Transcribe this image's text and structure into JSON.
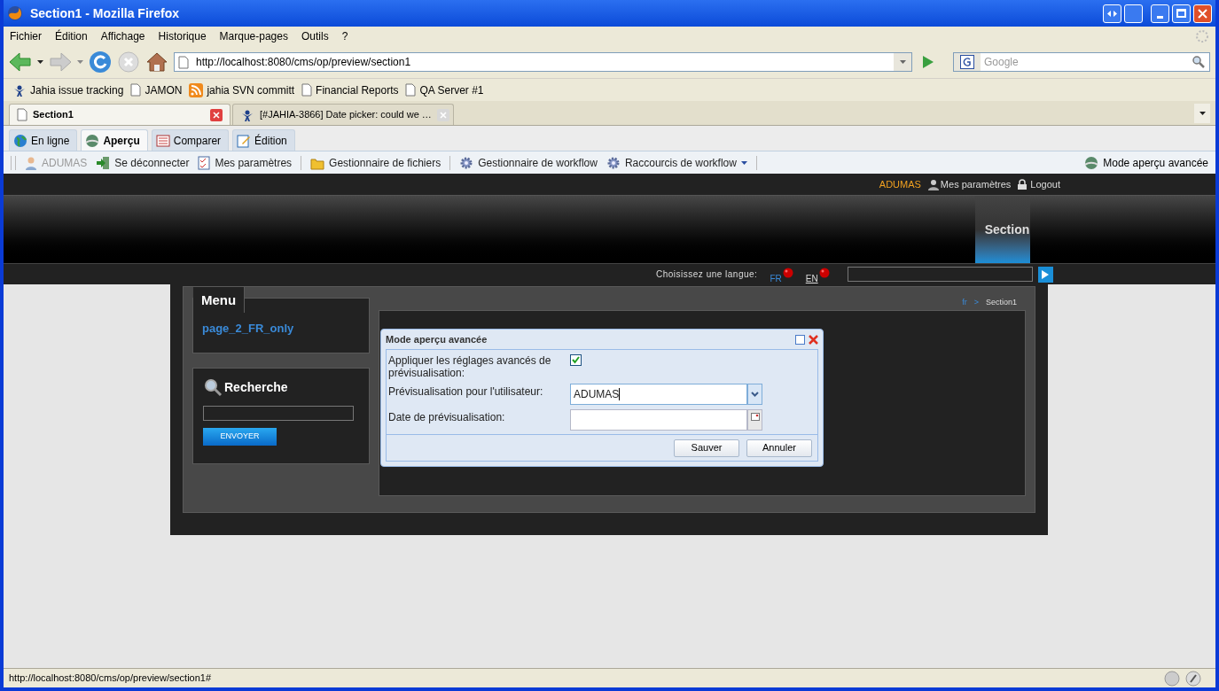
{
  "window": {
    "title": "Section1 - Mozilla Firefox"
  },
  "menu_bar": [
    "Fichier",
    "Édition",
    "Affichage",
    "Historique",
    "Marque-pages",
    "Outils",
    "?"
  ],
  "address_bar": {
    "value": "http://localhost:8080/cms/op/preview/section1"
  },
  "search": {
    "placeholder": "Google"
  },
  "bookmarks": [
    {
      "label": "Jahia issue tracking",
      "kind": "jahia"
    },
    {
      "label": "JAMON",
      "kind": "page"
    },
    {
      "label": "jahia SVN committ",
      "kind": "feed"
    },
    {
      "label": "Financial Reports",
      "kind": "page"
    },
    {
      "label": "QA Server #1",
      "kind": "page"
    }
  ],
  "browser_tabs": [
    {
      "label": "Section1",
      "selected": true,
      "kind": "page"
    },
    {
      "label": "[#JAHIA-3866] Date picker: could we …",
      "selected": false,
      "kind": "jahia"
    }
  ],
  "mode_tabs": [
    {
      "label": "En ligne",
      "selected": false,
      "kind": "globe"
    },
    {
      "label": "Aperçu",
      "selected": true,
      "kind": "preview"
    },
    {
      "label": "Comparer",
      "selected": false,
      "kind": "compare"
    },
    {
      "label": "Édition",
      "selected": false,
      "kind": "edit"
    }
  ],
  "toolbar": {
    "items": [
      {
        "label": "ADUMAS",
        "kind": "user",
        "disabled": true
      },
      {
        "label": "Se déconnecter",
        "kind": "logout",
        "disabled": false
      },
      {
        "label": "Mes paramètres",
        "kind": "settings",
        "disabled": false
      },
      {
        "label": "Gestionnaire de fichiers",
        "kind": "files",
        "disabled": false
      },
      {
        "label": "Gestionnaire de workflow",
        "kind": "gear",
        "disabled": false
      },
      {
        "label": "Raccourcis de workflow",
        "kind": "gear-menu",
        "disabled": false
      }
    ],
    "right": "Mode aperçu avancée"
  },
  "site_top": {
    "user": "ADUMAS",
    "settings": "Mes paramètres",
    "logout": "Logout"
  },
  "nav": {
    "item": "Section"
  },
  "language_bar": {
    "label": "Choisissez une langue:",
    "languages": [
      {
        "label": "FR",
        "selected": true
      },
      {
        "label": "EN",
        "selected": false
      }
    ]
  },
  "breadcrumb": [
    "fr",
    ">",
    "Section1"
  ],
  "menu_box": {
    "title": "Menu",
    "links": [
      "page_2_FR_only"
    ]
  },
  "search_box": {
    "title": "Recherche",
    "button": "ENVOYER"
  },
  "dialog": {
    "title": "Mode aperçu avancée",
    "fields": [
      {
        "label": "Appliquer les réglages avancés de prévisualisation:",
        "kind": "checkbox",
        "checked": true
      },
      {
        "label": "Prévisualisation pour l'utilisateur:",
        "kind": "combo",
        "value": "ADUMAS"
      },
      {
        "label": "Date de prévisualisation:",
        "kind": "date"
      }
    ],
    "buttons": [
      "Sauver",
      "Annuler"
    ]
  },
  "status_bar": {
    "text": "http://localhost:8080/cms/op/preview/section1#"
  }
}
